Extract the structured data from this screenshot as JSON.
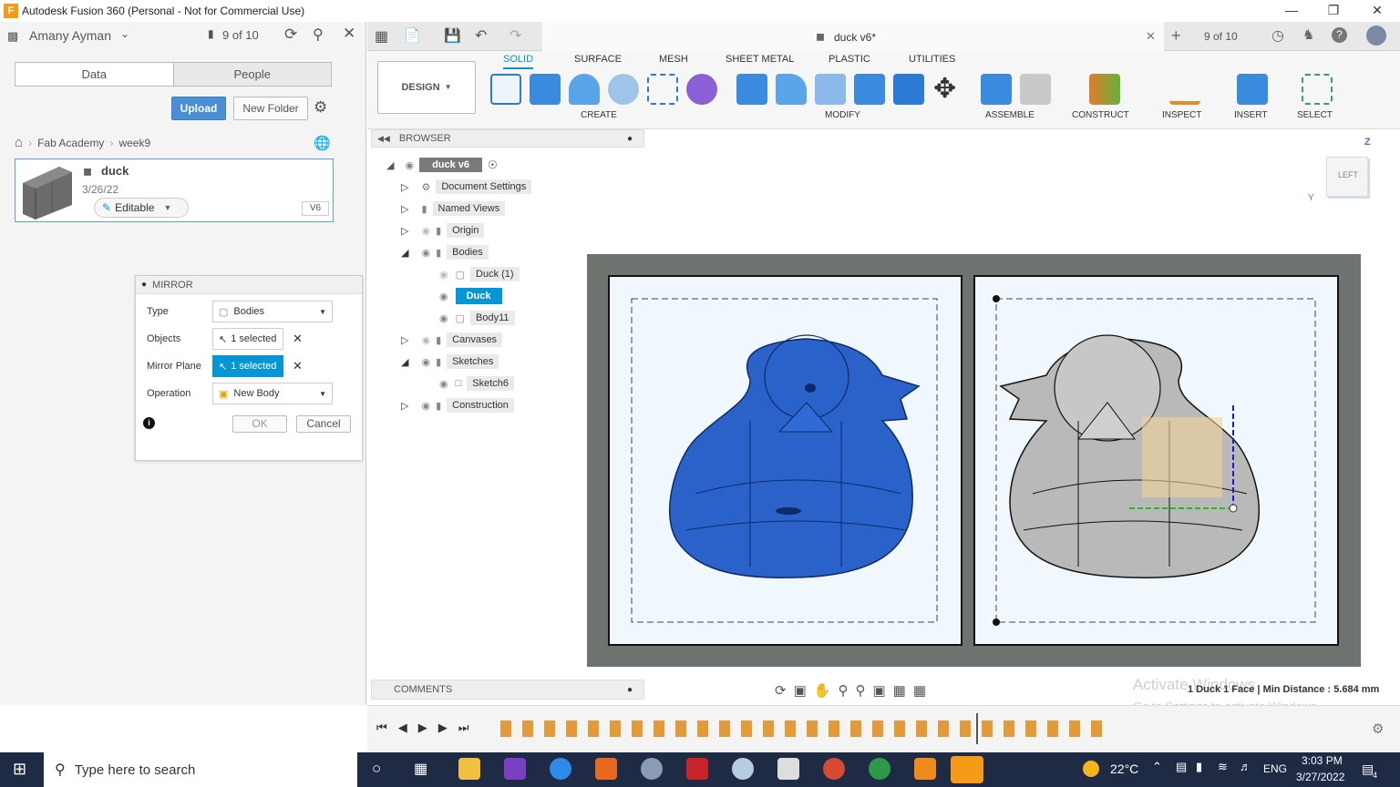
{
  "window": {
    "app_icon": "F",
    "title": "Autodesk Fusion 360 (Personal - Not for Commercial Use)"
  },
  "left_top": {
    "user": "Amany Ayman",
    "count": "9 of 10"
  },
  "data_tabs": [
    "Data",
    "People"
  ],
  "upload_label": "Upload",
  "new_folder_label": "New Folder",
  "breadcrumb": [
    "Fab Academy",
    "week9"
  ],
  "file": {
    "name": "duck",
    "date": "3/26/22",
    "status": "Editable",
    "version": "V6"
  },
  "mirror": {
    "title": "MIRROR",
    "type_label": "Type",
    "type_value": "Bodies",
    "objects_label": "Objects",
    "objects_value": "1 selected",
    "plane_label": "Mirror Plane",
    "plane_value": "1 selected",
    "operation_label": "Operation",
    "operation_value": "New Body",
    "ok": "OK",
    "cancel": "Cancel"
  },
  "doc_tab": {
    "title": "duck v6*",
    "count": "9 of 10"
  },
  "ribbon": {
    "workspace": "DESIGN",
    "tabs": [
      "SOLID",
      "SURFACE",
      "MESH",
      "SHEET METAL",
      "PLASTIC",
      "UTILITIES"
    ],
    "groups": [
      "CREATE",
      "MODIFY",
      "ASSEMBLE",
      "CONSTRUCT",
      "INSPECT",
      "INSERT",
      "SELECT"
    ]
  },
  "browser": {
    "title": "BROWSER",
    "root": "duck v6",
    "items": [
      "Document Settings",
      "Named Views",
      "Origin",
      "Bodies",
      "Duck (1)",
      "Duck",
      "Body11",
      "Canvases",
      "Sketches",
      "Sketch6",
      "Construction"
    ]
  },
  "comments": "COMMENTS",
  "viewcube": {
    "face": "LEFT",
    "z": "Z",
    "y": "Y"
  },
  "status": {
    "measure": "1 Duck 1 Face | Min Distance : 5.684 mm",
    "watermark1": "Activate Windows",
    "watermark2": "Go to Settings to activate Windows."
  },
  "taskbar": {
    "search": "Type here to search",
    "temp": "22°C",
    "lang": "ENG",
    "time": "3:03 PM",
    "date": "3/27/2022",
    "notif": "4"
  },
  "colors": {
    "accent": "#0696d7",
    "duck_blue": "#2a62c9",
    "duck_gray": "#b9b9b9",
    "frame": "#6e7370",
    "taskbar": "#1f2a44"
  }
}
